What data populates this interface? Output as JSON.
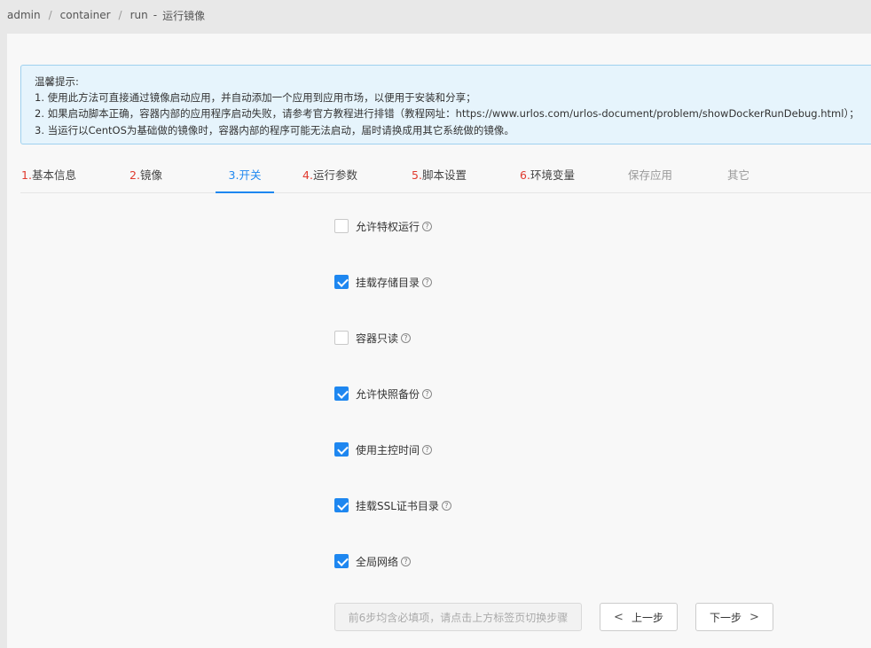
{
  "breadcrumb": {
    "items": [
      "admin",
      "container",
      "run"
    ],
    "separator": "/",
    "dash": "-",
    "current": "运行镜像"
  },
  "notice": {
    "title": "温馨提示:",
    "lines": [
      "1. 使用此方法可直接通过镜像启动应用，并自动添加一个应用到应用市场，以便用于安装和分享；",
      "2. 如果启动脚本正确，容器内部的应用程序启动失败，请参考官方教程进行排错（教程网址：https://www.urlos.com/urlos-document/problem/showDockerRunDebug.html）；",
      "3. 当运行以CentOS为基础做的镜像时，容器内部的程序可能无法启动，届时请换成用其它系统做的镜像。"
    ]
  },
  "tabs": [
    {
      "num": "1.",
      "label": "基本信息"
    },
    {
      "num": "2.",
      "label": "镜像"
    },
    {
      "num": "3.",
      "label": "开关"
    },
    {
      "num": "4.",
      "label": "运行参数"
    },
    {
      "num": "5.",
      "label": "脚本设置"
    },
    {
      "num": "6.",
      "label": "环境变量"
    },
    {
      "num": "",
      "label": "保存应用"
    },
    {
      "num": "",
      "label": "其它"
    }
  ],
  "options": [
    {
      "label": "允许特权运行",
      "checked": false
    },
    {
      "label": "挂载存储目录",
      "checked": true
    },
    {
      "label": "容器只读",
      "checked": false
    },
    {
      "label": "允许快照备份",
      "checked": true
    },
    {
      "label": "使用主控时间",
      "checked": true
    },
    {
      "label": "挂载SSL证书目录",
      "checked": true
    },
    {
      "label": "全局网络",
      "checked": true
    }
  ],
  "help_glyph": "?",
  "footer": {
    "hint": "前6步均含必填项，请点击上方标签页切换步骤",
    "prev_label": "上一步",
    "next_label": "下一步",
    "prev_glyph": "<",
    "next_glyph": ">"
  },
  "colors": {
    "accent": "#1e87f0",
    "step_number": "#e03a2e",
    "notice_bg": "#e6f4fc",
    "notice_border": "#9fd1ef"
  }
}
